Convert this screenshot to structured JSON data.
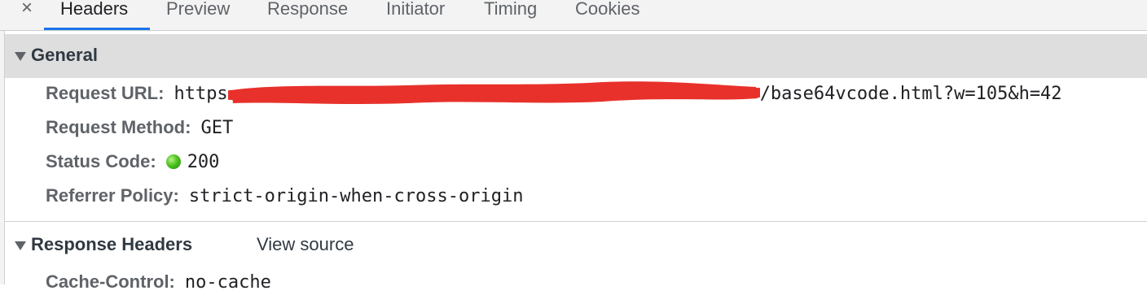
{
  "tabs": {
    "close_label": "×",
    "items": [
      {
        "label": "Headers",
        "active": true
      },
      {
        "label": "Preview",
        "active": false
      },
      {
        "label": "Response",
        "active": false
      },
      {
        "label": "Initiator",
        "active": false
      },
      {
        "label": "Timing",
        "active": false
      },
      {
        "label": "Cookies",
        "active": false
      }
    ]
  },
  "general": {
    "title": "General",
    "request_url_label": "Request URL:",
    "request_url_prefix": "https",
    "request_url_suffix": "/base64vcode.html?w=105&h=42",
    "request_method_label": "Request Method:",
    "request_method_value": "GET",
    "status_code_label": "Status Code:",
    "status_code_value": "200",
    "status_color": "#3cb818",
    "referrer_policy_label": "Referrer Policy:",
    "referrer_policy_value": "strict-origin-when-cross-origin"
  },
  "response_headers": {
    "title": "Response Headers",
    "view_source_label": "View source",
    "partial_row_label": "Cache-Control:",
    "partial_row_value": "no-cache"
  },
  "colors": {
    "accent": "#1a73e8",
    "redaction": "#e8312b"
  }
}
